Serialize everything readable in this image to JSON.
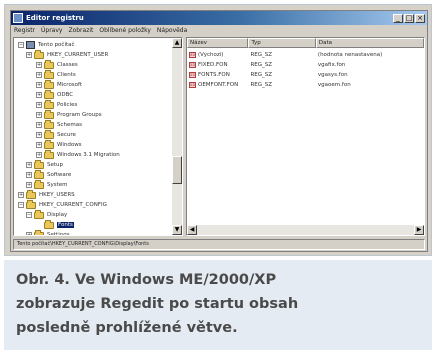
{
  "window": {
    "title": "Editor registru",
    "buttons": {
      "minimize": "_",
      "maximize": "□",
      "close": "×"
    }
  },
  "menubar": [
    "Registr",
    "Úpravy",
    "Zobrazit",
    "Oblíbené položky",
    "Nápověda"
  ],
  "tree": {
    "items": [
      {
        "label": "Tento počítač",
        "expander": "−",
        "selected": false
      },
      {
        "label": "HKEY_CURRENT_USER",
        "expander": "+",
        "selected": false
      },
      {
        "label": "Classes",
        "expander": "+",
        "selected": false
      },
      {
        "label": "Clients",
        "expander": "+",
        "selected": false
      },
      {
        "label": "Microsoft",
        "expander": "+",
        "selected": false
      },
      {
        "label": "ODBC",
        "expander": "+",
        "selected": false
      },
      {
        "label": "Policies",
        "expander": "+",
        "selected": false
      },
      {
        "label": "Program Groups",
        "expander": "+",
        "selected": false
      },
      {
        "label": "Schemas",
        "expander": "+",
        "selected": false
      },
      {
        "label": "Secure",
        "expander": "+",
        "selected": false
      },
      {
        "label": "Windows",
        "expander": "+",
        "selected": false
      },
      {
        "label": "Windows 3.1 Migration",
        "expander": "+",
        "selected": false
      },
      {
        "label": "Setup",
        "expander": "+",
        "selected": false
      },
      {
        "label": "Software",
        "expander": "+",
        "selected": false
      },
      {
        "label": "System",
        "expander": "+",
        "selected": false
      },
      {
        "label": "HKEY_USERS",
        "expander": "+",
        "selected": false
      },
      {
        "label": "HKEY_CURRENT_CONFIG",
        "expander": "−",
        "selected": false
      },
      {
        "label": "Display",
        "expander": "−",
        "selected": false
      },
      {
        "label": "Fonts",
        "expander": "",
        "selected": true
      },
      {
        "label": "Settings",
        "expander": "+",
        "selected": false
      },
      {
        "label": "Software",
        "expander": "+",
        "selected": false
      },
      {
        "label": "System",
        "expander": "+",
        "selected": false
      }
    ]
  },
  "list": {
    "columns": [
      "Název",
      "Typ",
      "Data"
    ],
    "rows": [
      {
        "name": "(Výchozí)",
        "type": "REG_SZ",
        "data": "(hodnota nenastavena)"
      },
      {
        "name": "FIXED.FON",
        "type": "REG_SZ",
        "data": "vgafix.fon"
      },
      {
        "name": "FONTS.FON",
        "type": "REG_SZ",
        "data": "vgasys.fon"
      },
      {
        "name": "OEMFONT.FON",
        "type": "REG_SZ",
        "data": "vgaoem.fon"
      }
    ],
    "value_icon": "ab"
  },
  "statusbar": "Tento počítač\\HKEY_CURRENT_CONFIG\\Display\\Fonts",
  "caption": {
    "lines": [
      "Obr. 4. Ve Windows ME/2000/XP",
      "zobrazuje Regedit po startu obsah",
      "posledně prohlížené větve."
    ]
  },
  "colors": {
    "caption_background": "#e4ebf2",
    "caption_text": "#4a4a4a",
    "titlebar_start": "#0a246a",
    "titlebar_end": "#a6caf0",
    "selection": "#0a246a"
  }
}
